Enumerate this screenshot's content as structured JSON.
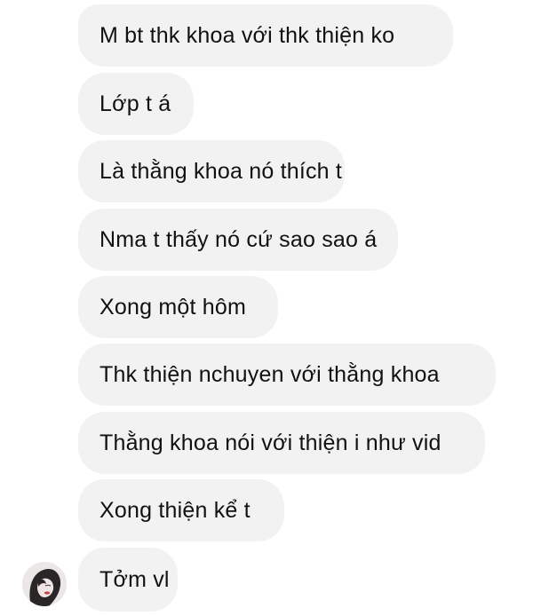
{
  "messages": [
    {
      "text": "M bt thk khoa với thk thiện ko"
    },
    {
      "text": "Lớp t á"
    },
    {
      "text": "Là thằng khoa nó thích t"
    },
    {
      "text": "Nma t thấy nó cứ sao sao á"
    },
    {
      "text": "Xong một hôm"
    },
    {
      "text": "Thk thiện nchuyen với thằng khoa"
    },
    {
      "text": "Thằng khoa nói với thiện i như vid"
    },
    {
      "text": "Xong thiện kể t"
    },
    {
      "text": "Tởm vl"
    }
  ],
  "avatar": {
    "icon": "contact-avatar"
  },
  "colors": {
    "bubble_background": "#f2f2f3",
    "text": "#111111",
    "page_background": "#ffffff"
  }
}
